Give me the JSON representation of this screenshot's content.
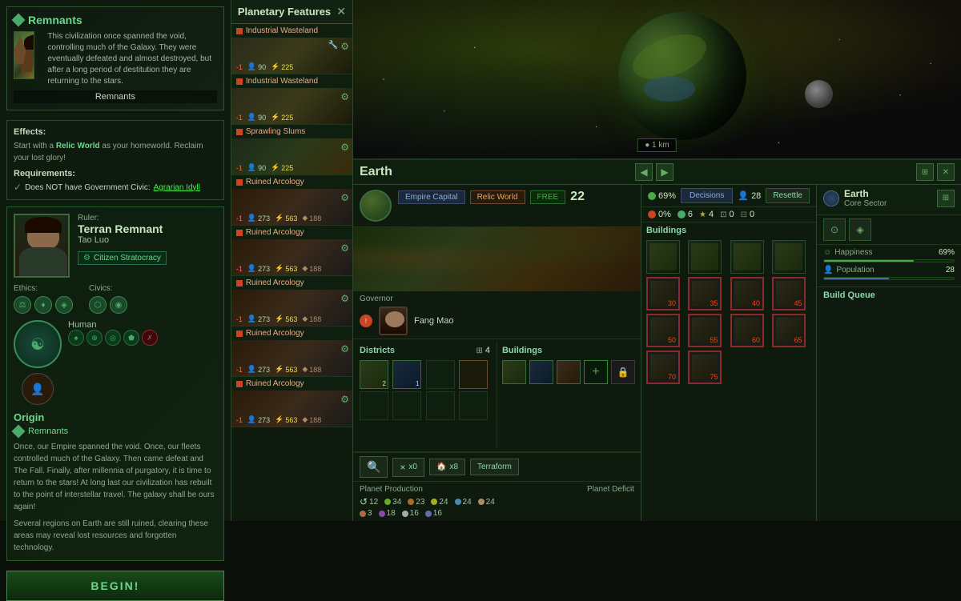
{
  "origin_card": {
    "title": "Remnants",
    "label": "Remnants",
    "description": "This civilization once spanned the void, controlling much of the Galaxy. They were eventually defeated and almost destroyed, but after a long period of destitution they are returning to the stars."
  },
  "effects": {
    "label": "Effects:",
    "text": "Start with a Relic World as your homeworld. Reclaim your lost glory!",
    "highlight": "Relic World"
  },
  "requirements": {
    "label": "Requirements:",
    "item": "Does NOT have Government Civic:",
    "civic": "Agrarian Idyll",
    "check": "✓"
  },
  "empire": {
    "ruler_label": "Ruler:",
    "name": "Terran Remnant",
    "ruler_name": "Tao Luo",
    "government": "Citizen Stratocracy",
    "ethics_label": "Ethics:",
    "civics_label": "Civics:",
    "species": "Human"
  },
  "origin_section": {
    "title": "Origin",
    "sub_label": "Remnants",
    "lore1": "Once, our Empire spanned the void. Once, our fleets controlled much of the Galaxy. Then came defeat and The Fall. Finally, after millennia of purgatory, it is time to return to the stars! At long last our civilization has rebuilt to the point of interstellar travel. The galaxy shall be ours again!",
    "lore2": "Several regions on Earth are still ruined, clearing these areas may reveal lost resources and forgotten technology."
  },
  "begin_button": "BEGIN!",
  "planetary_features": {
    "title": "Planetary Features",
    "close": "✕",
    "items": [
      {
        "name": "Industrial Wasteland",
        "neg": "-1",
        "pop": "90",
        "energy": "225"
      },
      {
        "name": "Industrial Wasteland",
        "neg": "-1",
        "pop": "90",
        "energy": "225"
      },
      {
        "name": "Sprawling Slums",
        "neg": "-1",
        "pop": "90",
        "energy": "225"
      },
      {
        "name": "Ruined Arcology",
        "neg": "-1",
        "pop": "273",
        "energy": "563",
        "extra": "188"
      },
      {
        "name": "Ruined Arcology",
        "neg": "-1",
        "pop": "273",
        "energy": "563",
        "extra": "188"
      },
      {
        "name": "Ruined Arcology",
        "neg": "-1",
        "pop": "273",
        "energy": "563",
        "extra": "188"
      },
      {
        "name": "Ruined Arcology",
        "neg": "-1",
        "pop": "273",
        "energy": "563",
        "extra": "188"
      },
      {
        "name": "Ruined Arcology",
        "neg": "-1",
        "pop": "273",
        "energy": "563",
        "extra": "188"
      }
    ]
  },
  "earth": {
    "title": "Earth",
    "badge_empire": "Empire Capital",
    "badge_relic": "Relic World",
    "badge_status": "FREE",
    "size": "22",
    "governor_label": "Governor",
    "governor_name": "Fang Mao",
    "districts_label": "Districts",
    "districts_count": "4",
    "buildings_label": "Buildings",
    "terraform_btn": "Terraform",
    "planet_production_label": "Planet Production",
    "planet_deficit_label": "Planet Deficit",
    "production": {
      "pop": "12",
      "food": "34",
      "minerals": "23",
      "energy": "24",
      "research": "24",
      "consumer": "24",
      "unity": "3",
      "influence": "18",
      "amenities": "16",
      "housing": "16"
    }
  },
  "sector": {
    "icon_label": "earth-icon",
    "name": "Earth",
    "sub": "Core Sector"
  },
  "top_stats": {
    "happiness": "69%",
    "pop_count": "28",
    "crime": "0%",
    "stability": "6",
    "amenities": "4",
    "housing_free": "0",
    "housing_total": "0",
    "decisions_btn": "Decisions",
    "resettle_btn": "Resettle"
  },
  "build_queue": {
    "title": "Build Queue",
    "empty": ""
  },
  "buildings_grid": {
    "numbers": [
      "30",
      "35",
      "40",
      "45",
      "50",
      "55",
      "60",
      "65",
      "70",
      "75"
    ]
  }
}
